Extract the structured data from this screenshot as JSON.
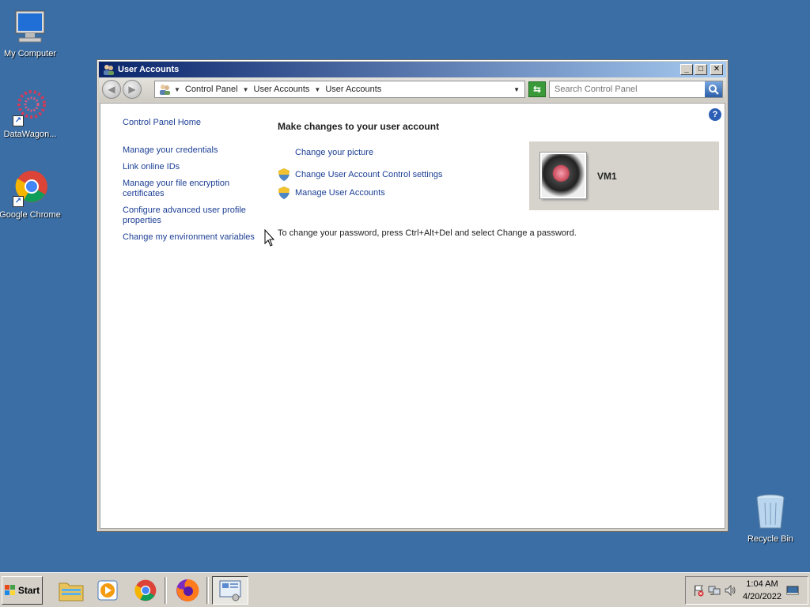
{
  "desktop": {
    "icons": [
      {
        "label": "My Computer"
      },
      {
        "label": "DataWagon..."
      },
      {
        "label": "Google Chrome"
      },
      {
        "label": "Recycle Bin"
      }
    ]
  },
  "window": {
    "title": "User Accounts",
    "controls": {
      "minimize": "_",
      "maximize": "□",
      "close": "✕"
    },
    "address": {
      "crumbs": [
        "Control Panel",
        "User Accounts",
        "User Accounts"
      ]
    },
    "search": {
      "placeholder": "Search Control Panel"
    },
    "help": "?",
    "leftnav": {
      "home": "Control Panel Home",
      "links": [
        "Manage your credentials",
        "Link online IDs",
        "Manage your file encryption certificates",
        "Configure advanced user profile properties",
        "Change my environment variables"
      ]
    },
    "main": {
      "heading": "Make changes to your user account",
      "tasks": [
        {
          "label": "Change your picture",
          "icon": "none"
        },
        {
          "label": "Change User Account Control settings",
          "icon": "uac-shield-icon"
        },
        {
          "label": "Manage User Accounts",
          "icon": "uac-shield-icon"
        }
      ],
      "note": "To change your password, press Ctrl+Alt+Del and select Change a password.",
      "user": {
        "name": "VM1"
      }
    }
  },
  "taskbar": {
    "start_label": "Start",
    "clock": {
      "time": "1:04 AM",
      "date": "4/20/2022"
    }
  }
}
